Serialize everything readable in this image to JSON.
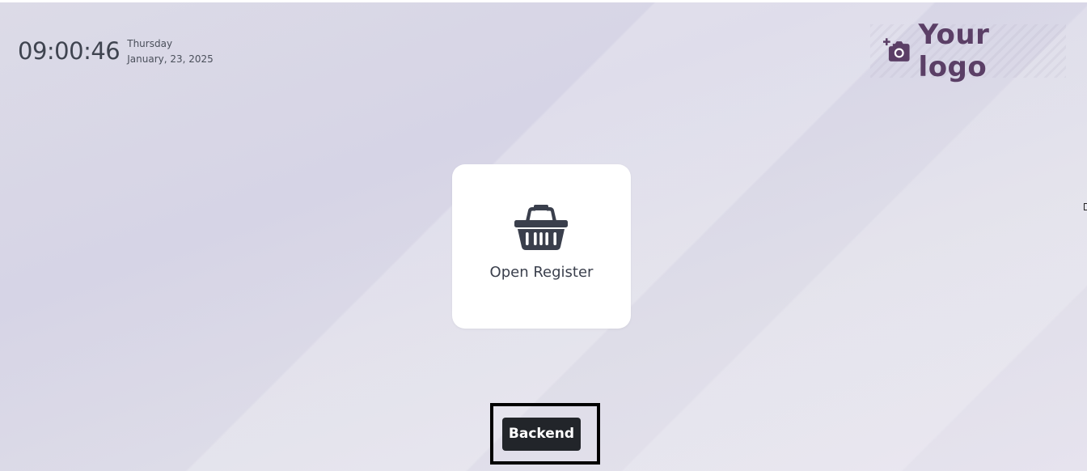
{
  "clock": {
    "time": "09:00:46",
    "weekday": "Thursday",
    "date": "January, 23, 2025"
  },
  "logo": {
    "text": "Your logo",
    "icon": "camera-plus-icon",
    "color": "#5b3f66"
  },
  "register": {
    "label": "Open Register",
    "icon": "basket-icon"
  },
  "backend": {
    "label": "Backend"
  },
  "colors": {
    "button_bg": "#22252a",
    "text_dark": "#3a3f4c"
  }
}
